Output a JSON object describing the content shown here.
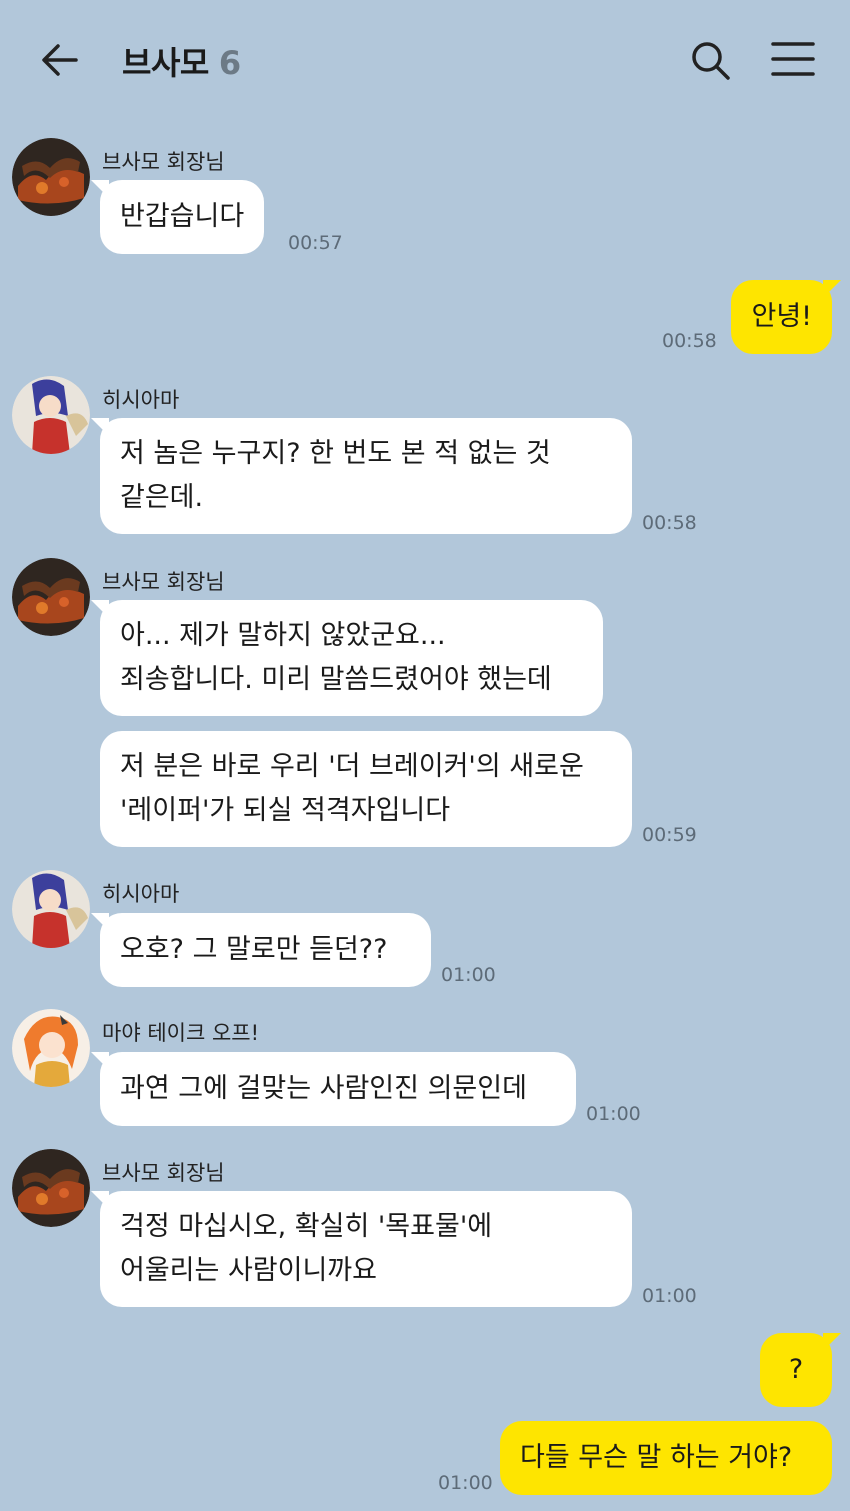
{
  "header": {
    "title": "브사모",
    "member_count": "6"
  },
  "messages": [
    {
      "sender": "브사모 회장님",
      "lines": [
        "반갑습니다"
      ],
      "time": "00:57"
    },
    {
      "sender": "me",
      "lines": [
        "안녕!"
      ],
      "time": "00:58"
    },
    {
      "sender": "히시아마",
      "lines": [
        "저 놈은 누구지? 한 번도 본 적 없는 것",
        "같은데."
      ],
      "time": "00:58"
    },
    {
      "sender": "브사모 회장님",
      "lines": [
        "아... 제가 말하지 않았군요...",
        "죄송합니다. 미리 말씀드렸어야 했는데"
      ]
    },
    {
      "sender": "브사모 회장님",
      "lines": [
        "저 분은 바로 우리 '더 브레이커'의 새로운",
        "'레이퍼'가 되실 적격자입니다"
      ],
      "time": "00:59"
    },
    {
      "sender": "히시아마",
      "lines": [
        "오호? 그 말로만 듣던??"
      ],
      "time": "01:00"
    },
    {
      "sender": "마야 테이크 오프!",
      "lines": [
        "과연 그에 걸맞는 사람인진 의문인데"
      ],
      "time": "01:00"
    },
    {
      "sender": "브사모 회장님",
      "lines": [
        "걱정 마십시오, 확실히 '목표물'에",
        "어울리는 사람이니까요"
      ],
      "time": "01:00"
    },
    {
      "sender": "me",
      "lines": [
        "?"
      ]
    },
    {
      "sender": "me",
      "lines": [
        "다들 무슨 말 하는 거야?"
      ],
      "time": "01:00"
    }
  ],
  "colors": {
    "background": "#b2c7da",
    "my_bubble": "#fee500",
    "other_bubble": "#ffffff"
  },
  "icons": [
    "back-arrow-icon",
    "search-icon",
    "menu-icon"
  ]
}
